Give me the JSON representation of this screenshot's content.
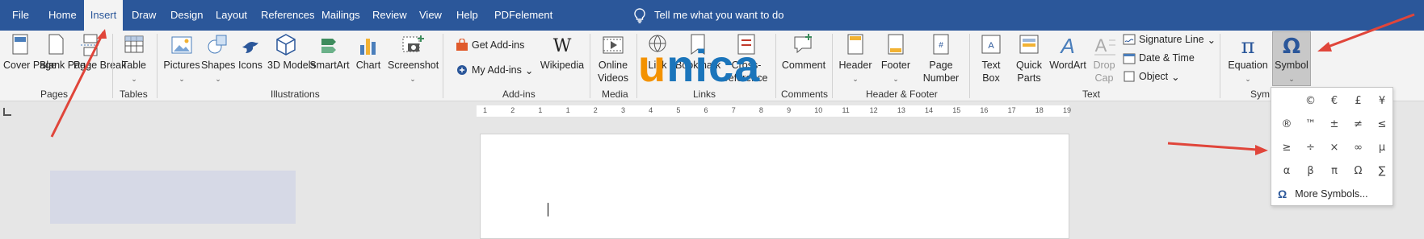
{
  "tabs": [
    {
      "label": "File"
    },
    {
      "label": "Home"
    },
    {
      "label": "Insert"
    },
    {
      "label": "Draw"
    },
    {
      "label": "Design"
    },
    {
      "label": "Layout"
    },
    {
      "label": "References"
    },
    {
      "label": "Mailings"
    },
    {
      "label": "Review"
    },
    {
      "label": "View"
    },
    {
      "label": "Help"
    },
    {
      "label": "PDFelement"
    }
  ],
  "tell_me": "Tell me what you want to do",
  "groups": {
    "pages": {
      "label": "Pages",
      "cover_page": "Cover Page",
      "blank_page": "Blank Page",
      "page_break": "Page Break"
    },
    "tables": {
      "label": "Tables",
      "table": "Table"
    },
    "illustrations": {
      "label": "Illustrations",
      "pictures": "Pictures",
      "shapes": "Shapes",
      "icons": "Icons",
      "models": "3D Models",
      "smartart": "SmartArt",
      "chart": "Chart",
      "screenshot": "Screenshot"
    },
    "addins": {
      "label": "Add-ins",
      "get": "Get Add-ins",
      "my": "My Add-ins",
      "wikipedia": "Wikipedia"
    },
    "media": {
      "label": "Media",
      "online_videos": "Online Videos"
    },
    "links": {
      "label": "Links",
      "link": "Link",
      "bookmark": "Bookmark",
      "cross_ref": "Cross-reference"
    },
    "comments": {
      "label": "Comments",
      "comment": "Comment"
    },
    "header_footer": {
      "label": "Header & Footer",
      "header": "Header",
      "footer": "Footer",
      "page_number": "Page Number"
    },
    "text": {
      "label": "Text",
      "text_box": "Text Box",
      "quick_parts": "Quick Parts",
      "wordart": "WordArt",
      "drop_cap": "Drop Cap",
      "signature_line": "Signature Line",
      "date_time": "Date & Time",
      "object": "Object"
    },
    "symbols": {
      "label": "Symbols",
      "equation": "Equation",
      "symbol": "Symbol"
    }
  },
  "ruler_ticks": [
    "1",
    "2",
    "1",
    "1",
    "2",
    "3",
    "4",
    "5",
    "6",
    "7",
    "8",
    "9",
    "10",
    "11",
    "12",
    "13",
    "14",
    "15",
    "16",
    "17",
    "18",
    "19"
  ],
  "symbol_dropdown": {
    "symbols": [
      "",
      "©",
      "€",
      "£",
      "¥",
      "®",
      "™",
      "±",
      "≠",
      "≤",
      "≥",
      "÷",
      "×",
      "∞",
      "µ",
      "α",
      "β",
      "π",
      "Ω",
      "∑"
    ],
    "more": "More Symbols..."
  },
  "watermark": {
    "u": "u",
    "rest": "nica"
  },
  "colors": {
    "title_bar": "#2b579a",
    "accent_arrow": "#e0453a",
    "unica_orange": "#f39200",
    "unica_blue": "#1b75bb"
  }
}
